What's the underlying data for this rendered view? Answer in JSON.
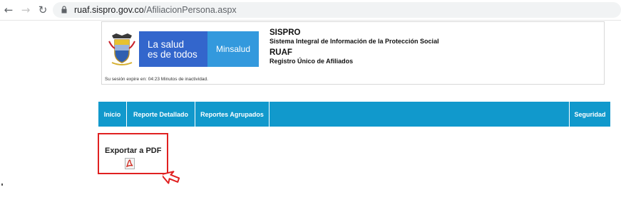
{
  "browser": {
    "back_icon": "arrow-left-icon",
    "forward_icon": "arrow-right-icon",
    "reload_icon": "reload-icon",
    "url_host": "ruaf.sispro.gov.co",
    "url_path": "/AfiliacionPersona.aspx"
  },
  "header": {
    "banner_line1": "La salud",
    "banner_line2": "es de todos",
    "banner_ministry": "Minsalud",
    "system_title": "SISPRO",
    "system_subtitle": "Sistema Integral de Información de la Protección Social",
    "ruaf_title": "RUAF",
    "ruaf_subtitle": "Registro Único de Afiliados",
    "session_text": "Su sesión expire en: 04:23 Minutos de inactividad."
  },
  "menu": {
    "items": [
      {
        "label": "Inicio"
      },
      {
        "label": "Reporte Detallado"
      },
      {
        "label": "Reportes Agrupados"
      }
    ],
    "right_item": {
      "label": "Seguridad"
    }
  },
  "export": {
    "label": "Exportar a PDF",
    "icon": "pdf-icon"
  },
  "colors": {
    "menu_bg": "#1199cc",
    "banner_blue": "#3366cc",
    "banner_light": "#3399dd",
    "highlight": "#e02020"
  }
}
